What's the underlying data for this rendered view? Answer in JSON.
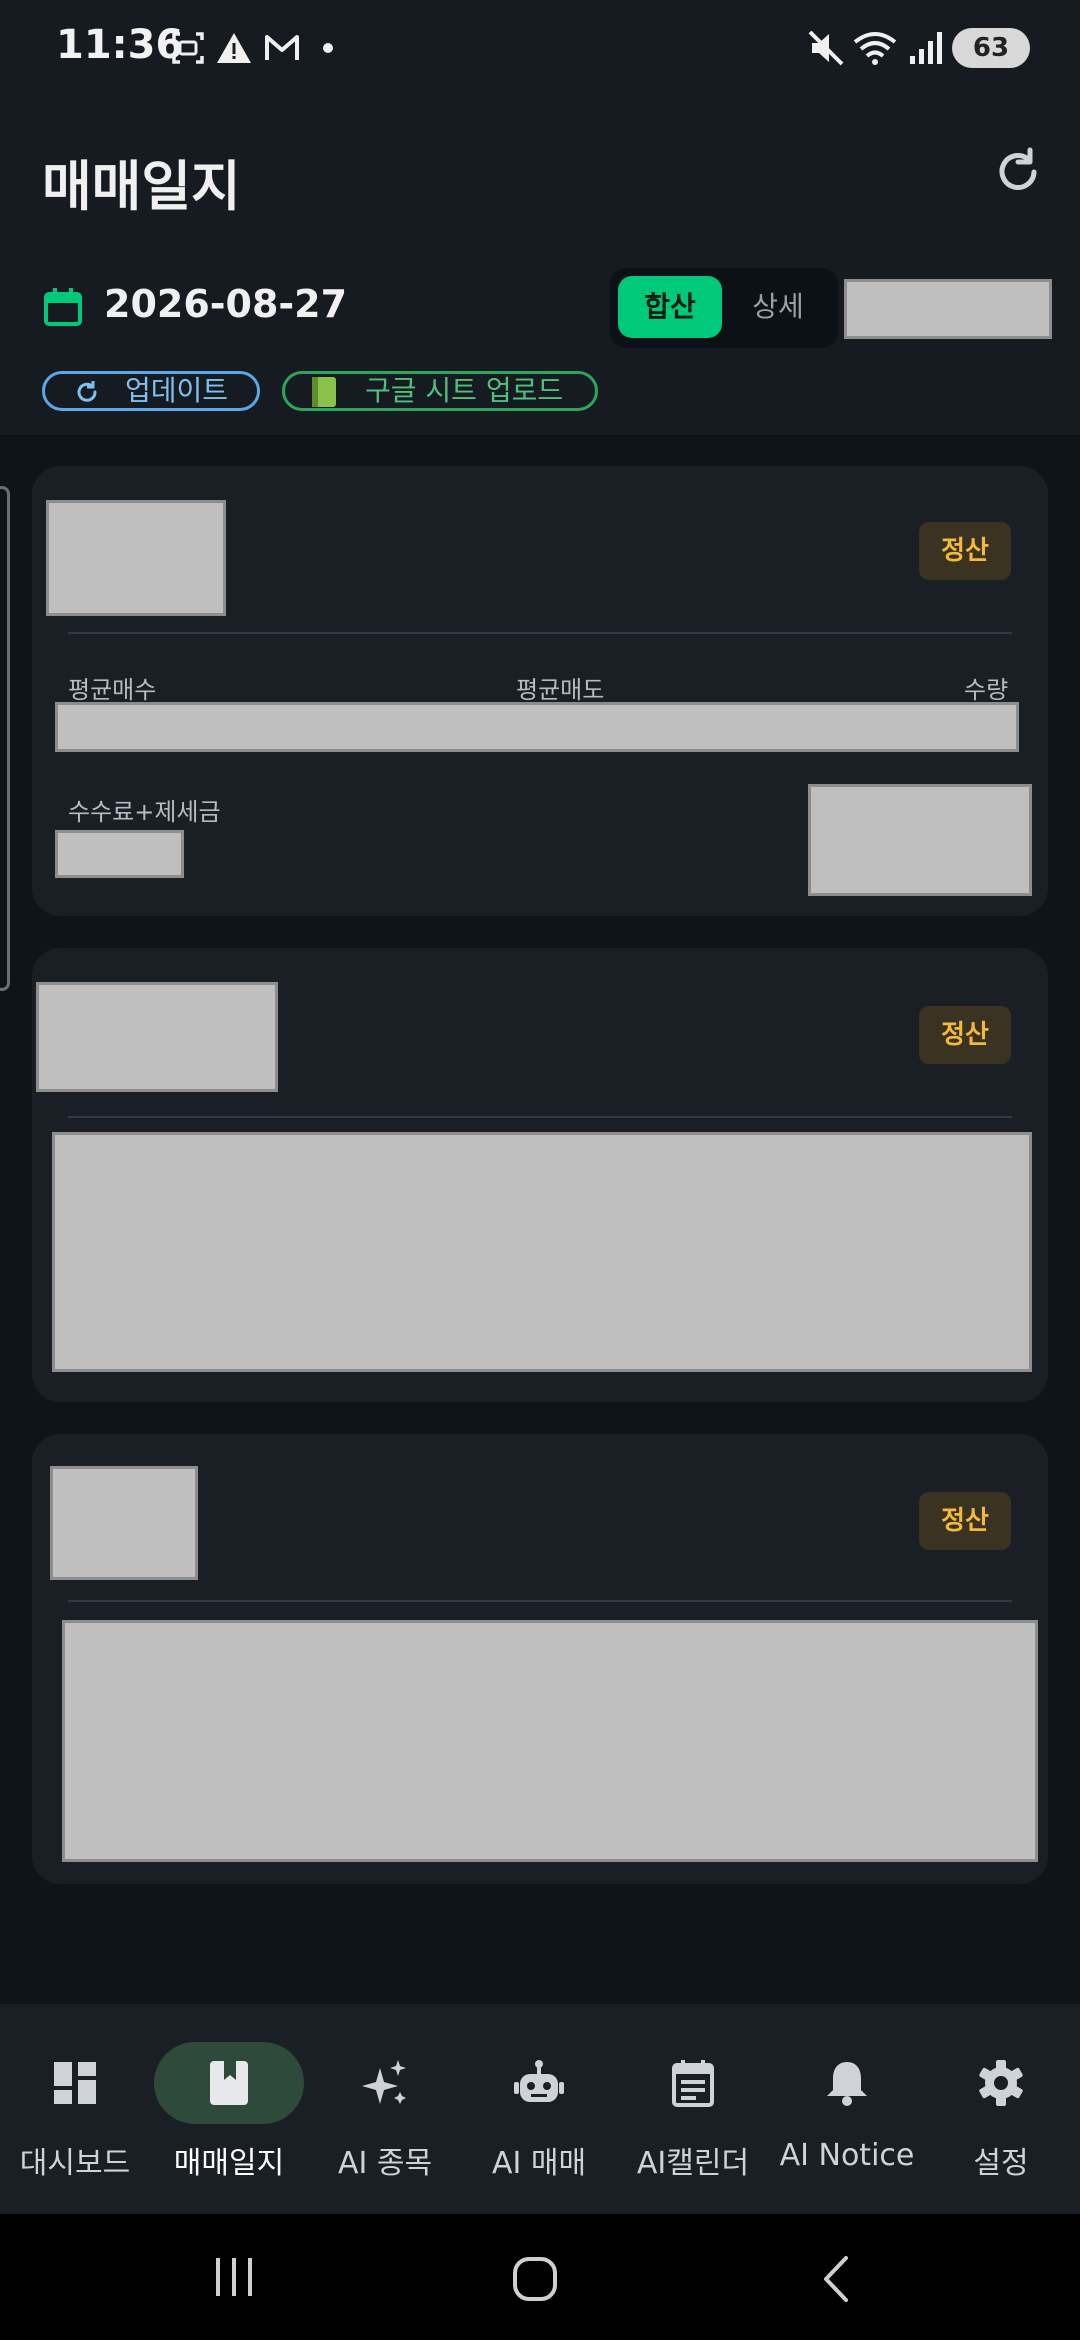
{
  "status_bar": {
    "time": "11:36",
    "battery": "63",
    "icons": [
      "screenshot-icon",
      "warning-icon",
      "gmail-icon",
      "dot-icon",
      "mute-icon",
      "wifi-icon",
      "signal-icon",
      "battery-icon"
    ]
  },
  "header": {
    "title": "매매일지",
    "date": "2026-08-27",
    "segment": {
      "sum": "합산",
      "detail": "상세"
    },
    "update_label": "업데이트",
    "upload_label": "구글 시트 업로드",
    "accent_color": "#00c97a"
  },
  "cards": [
    {
      "badge": "정산",
      "labels": {
        "avg_buy": "평균매수",
        "avg_sell": "평균매도",
        "qty": "수량",
        "fee": "수수료+제세금"
      }
    },
    {
      "badge": "정산"
    },
    {
      "badge": "정산"
    }
  ],
  "nav": {
    "items": [
      {
        "label": "대시보드",
        "icon": "dashboard-icon"
      },
      {
        "label": "매매일지",
        "icon": "journal-icon"
      },
      {
        "label": "AI 종목",
        "icon": "sparkle-icon"
      },
      {
        "label": "AI 매매",
        "icon": "robot-icon"
      },
      {
        "label": "AI캘린더",
        "icon": "calendar-note-icon"
      },
      {
        "label": "AI Notice",
        "icon": "bell-icon"
      },
      {
        "label": "설정",
        "icon": "gear-icon"
      }
    ],
    "active_index": 1
  }
}
